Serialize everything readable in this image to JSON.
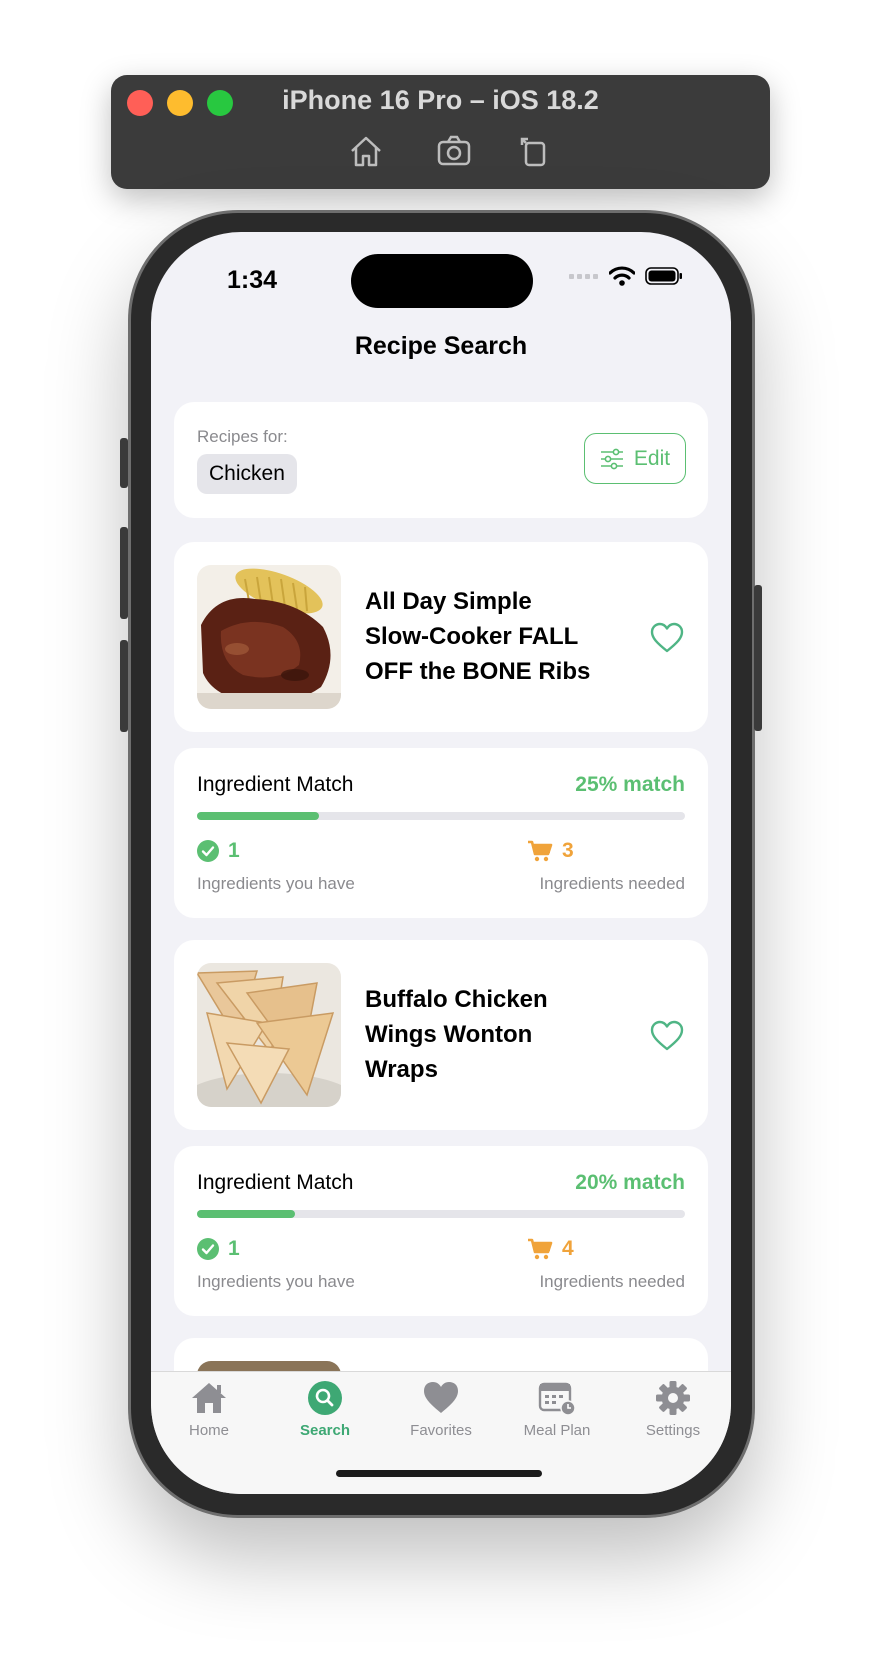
{
  "simulator": {
    "title": "iPhone 16 Pro – iOS 18.2",
    "tools": [
      "home-icon",
      "screenshot-icon",
      "rotate-icon"
    ]
  },
  "status_bar": {
    "time": "1:34"
  },
  "nav": {
    "title": "Recipe Search"
  },
  "filter": {
    "label": "Recipes for:",
    "chip": "Chicken",
    "edit_label": "Edit"
  },
  "recipes": [
    {
      "title": "All Day Simple Slow-Cooker FALL OFF the BONE Ribs",
      "match_title": "Ingredient Match",
      "match_pct_label": "25% match",
      "match_fraction": 0.25,
      "have_count": "1",
      "have_label": "Ingredients you have",
      "need_count": "3",
      "need_label": "Ingredients needed"
    },
    {
      "title": "Buffalo Chicken Wings Wonton Wraps",
      "match_title": "Ingredient Match",
      "match_pct_label": "20% match",
      "match_fraction": 0.2,
      "have_count": "1",
      "have_label": "Ingredients you have",
      "need_count": "4",
      "need_label": "Ingredients needed"
    }
  ],
  "tabs": [
    {
      "label": "Home",
      "icon": "home-icon"
    },
    {
      "label": "Search",
      "icon": "search-icon"
    },
    {
      "label": "Favorites",
      "icon": "heart-icon"
    },
    {
      "label": "Meal Plan",
      "icon": "calendar-icon"
    },
    {
      "label": "Settings",
      "icon": "gear-icon"
    }
  ],
  "colors": {
    "accent": "#5bbf72",
    "warning": "#f0a33a",
    "tab_active": "#3ea874"
  }
}
